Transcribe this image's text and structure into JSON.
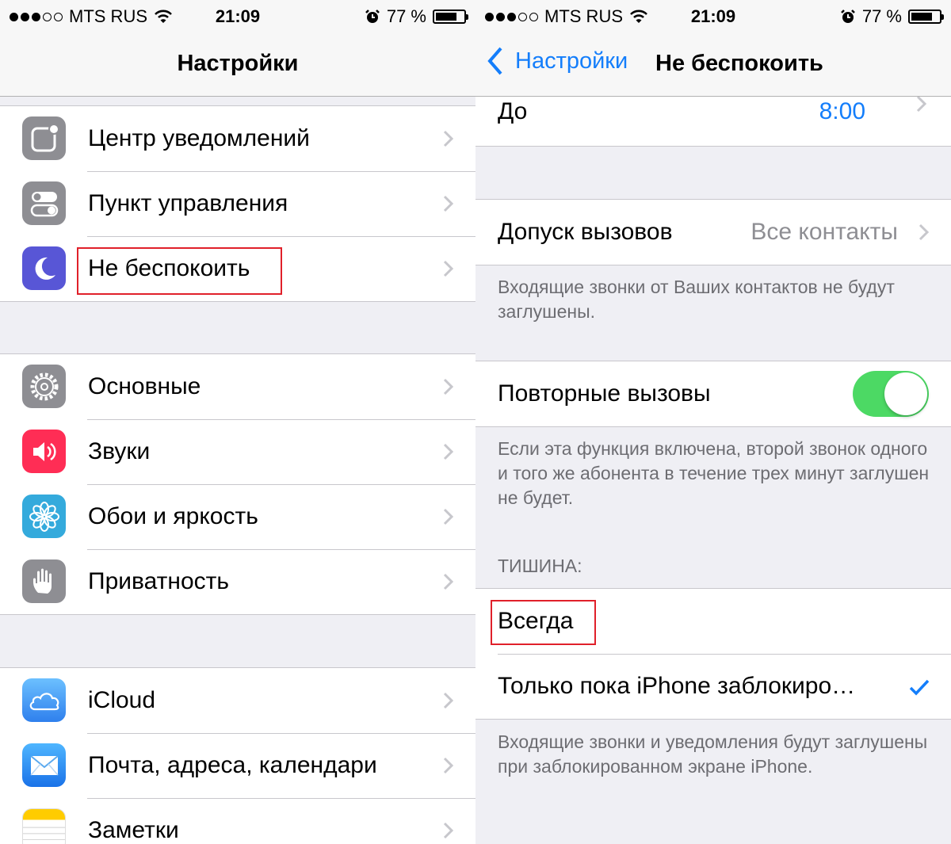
{
  "status": {
    "carrier": "MTS RUS",
    "time": "21:09",
    "battery": "77 %"
  },
  "left": {
    "nav_title": "Настройки",
    "groups": [
      [
        {
          "label": "Центр уведомлений",
          "icon": "notification-center-icon",
          "color": "#8e8e93"
        },
        {
          "label": "Пункт управления",
          "icon": "control-center-icon",
          "color": "#8e8e93"
        },
        {
          "label": "Не беспокоить",
          "icon": "moon-icon",
          "color": "#5856d6"
        }
      ],
      [
        {
          "label": "Основные",
          "icon": "gear-icon",
          "color": "#8e8e93"
        },
        {
          "label": "Звуки",
          "icon": "speaker-icon",
          "color": "#ff2d55"
        },
        {
          "label": "Обои и яркость",
          "icon": "flower-icon",
          "color": "#34aadc"
        },
        {
          "label": "Приватность",
          "icon": "hand-icon",
          "color": "#8e8e93"
        }
      ],
      [
        {
          "label": "iCloud",
          "icon": "cloud-icon",
          "color": "#3c9bf0"
        },
        {
          "label": "Почта, адреса, календари",
          "icon": "mail-icon",
          "color": "#1a8cf0"
        },
        {
          "label": "Заметки",
          "icon": "notes-icon",
          "color": "#ffcc00"
        }
      ]
    ]
  },
  "right": {
    "back_label": "Настройки",
    "nav_title": "Не беспокоить",
    "until": {
      "label": "До",
      "value": "8:00"
    },
    "allow_calls": {
      "label": "Допуск вызовов",
      "value": "Все контакты"
    },
    "allow_calls_footer": "Входящие звонки от Ваших контактов не будут заглушены.",
    "repeated_calls": {
      "label": "Повторные вызовы",
      "on": true
    },
    "repeated_calls_footer": "Если эта функция включена, второй звонок одного и того же абонента в течение трех минут заглушен не будет.",
    "silence_header": "ТИШИНА:",
    "silence_always": "Всегда",
    "silence_locked": "Только пока iPhone заблокиро…",
    "silence_footer": "Входящие звонки и уведомления будут заглушены при заблокированном экране iPhone."
  },
  "colors": {
    "accent": "#147efb",
    "toggle_on": "#4cd964",
    "highlight": "#e0202a"
  }
}
